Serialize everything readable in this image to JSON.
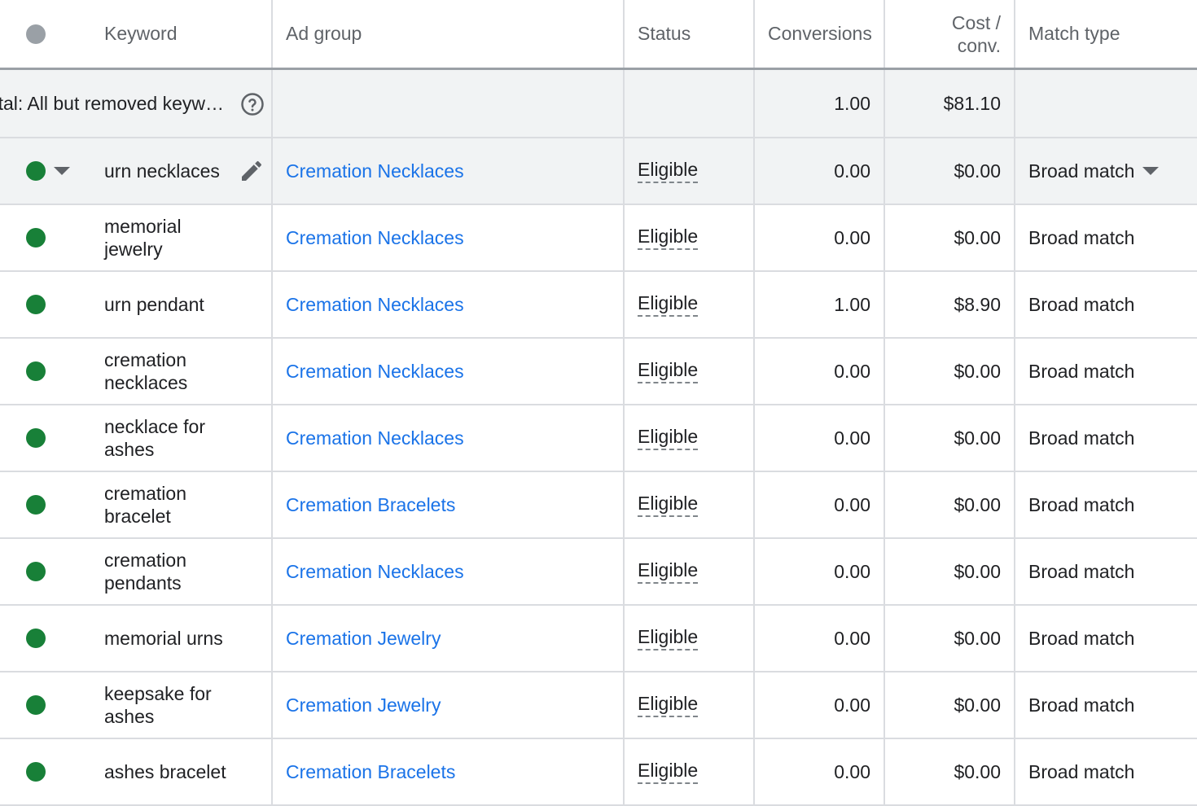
{
  "header": {
    "keyword": "Keyword",
    "ad_group": "Ad group",
    "status": "Status",
    "conversions": "Conversions",
    "cost_conv_line1": "Cost /",
    "cost_conv_line2": "conv.",
    "match_type": "Match type"
  },
  "total": {
    "label": "Total: All but removed keyw…",
    "conversions": "1.00",
    "cost_conv": "$81.10"
  },
  "colors": {
    "eligible_dot": "#188038",
    "link": "#1a73e8",
    "header_dot": "#9aa0a6"
  },
  "rows": [
    {
      "keyword": "urn necklaces",
      "ad_group": "Cremation Necklaces",
      "status": "Eligible",
      "conversions": "0.00",
      "cost_conv": "$0.00",
      "match_type": "Broad match"
    },
    {
      "keyword": "memorial jewelry",
      "ad_group": "Cremation Necklaces",
      "status": "Eligible",
      "conversions": "0.00",
      "cost_conv": "$0.00",
      "match_type": "Broad match"
    },
    {
      "keyword": "urn pendant",
      "ad_group": "Cremation Necklaces",
      "status": "Eligible",
      "conversions": "1.00",
      "cost_conv": "$8.90",
      "match_type": "Broad match"
    },
    {
      "keyword": "cremation necklaces",
      "ad_group": "Cremation Necklaces",
      "status": "Eligible",
      "conversions": "0.00",
      "cost_conv": "$0.00",
      "match_type": "Broad match"
    },
    {
      "keyword": "necklace for ashes",
      "ad_group": "Cremation Necklaces",
      "status": "Eligible",
      "conversions": "0.00",
      "cost_conv": "$0.00",
      "match_type": "Broad match"
    },
    {
      "keyword": "cremation bracelet",
      "ad_group": "Cremation Bracelets",
      "status": "Eligible",
      "conversions": "0.00",
      "cost_conv": "$0.00",
      "match_type": "Broad match"
    },
    {
      "keyword": "cremation pendants",
      "ad_group": "Cremation Necklaces",
      "status": "Eligible",
      "conversions": "0.00",
      "cost_conv": "$0.00",
      "match_type": "Broad match"
    },
    {
      "keyword": "memorial urns",
      "ad_group": "Cremation Jewelry",
      "status": "Eligible",
      "conversions": "0.00",
      "cost_conv": "$0.00",
      "match_type": "Broad match"
    },
    {
      "keyword": "keepsake for ashes",
      "ad_group": "Cremation Jewelry",
      "status": "Eligible",
      "conversions": "0.00",
      "cost_conv": "$0.00",
      "match_type": "Broad match"
    },
    {
      "keyword": "ashes bracelet",
      "ad_group": "Cremation Bracelets",
      "status": "Eligible",
      "conversions": "0.00",
      "cost_conv": "$0.00",
      "match_type": "Broad match"
    }
  ]
}
